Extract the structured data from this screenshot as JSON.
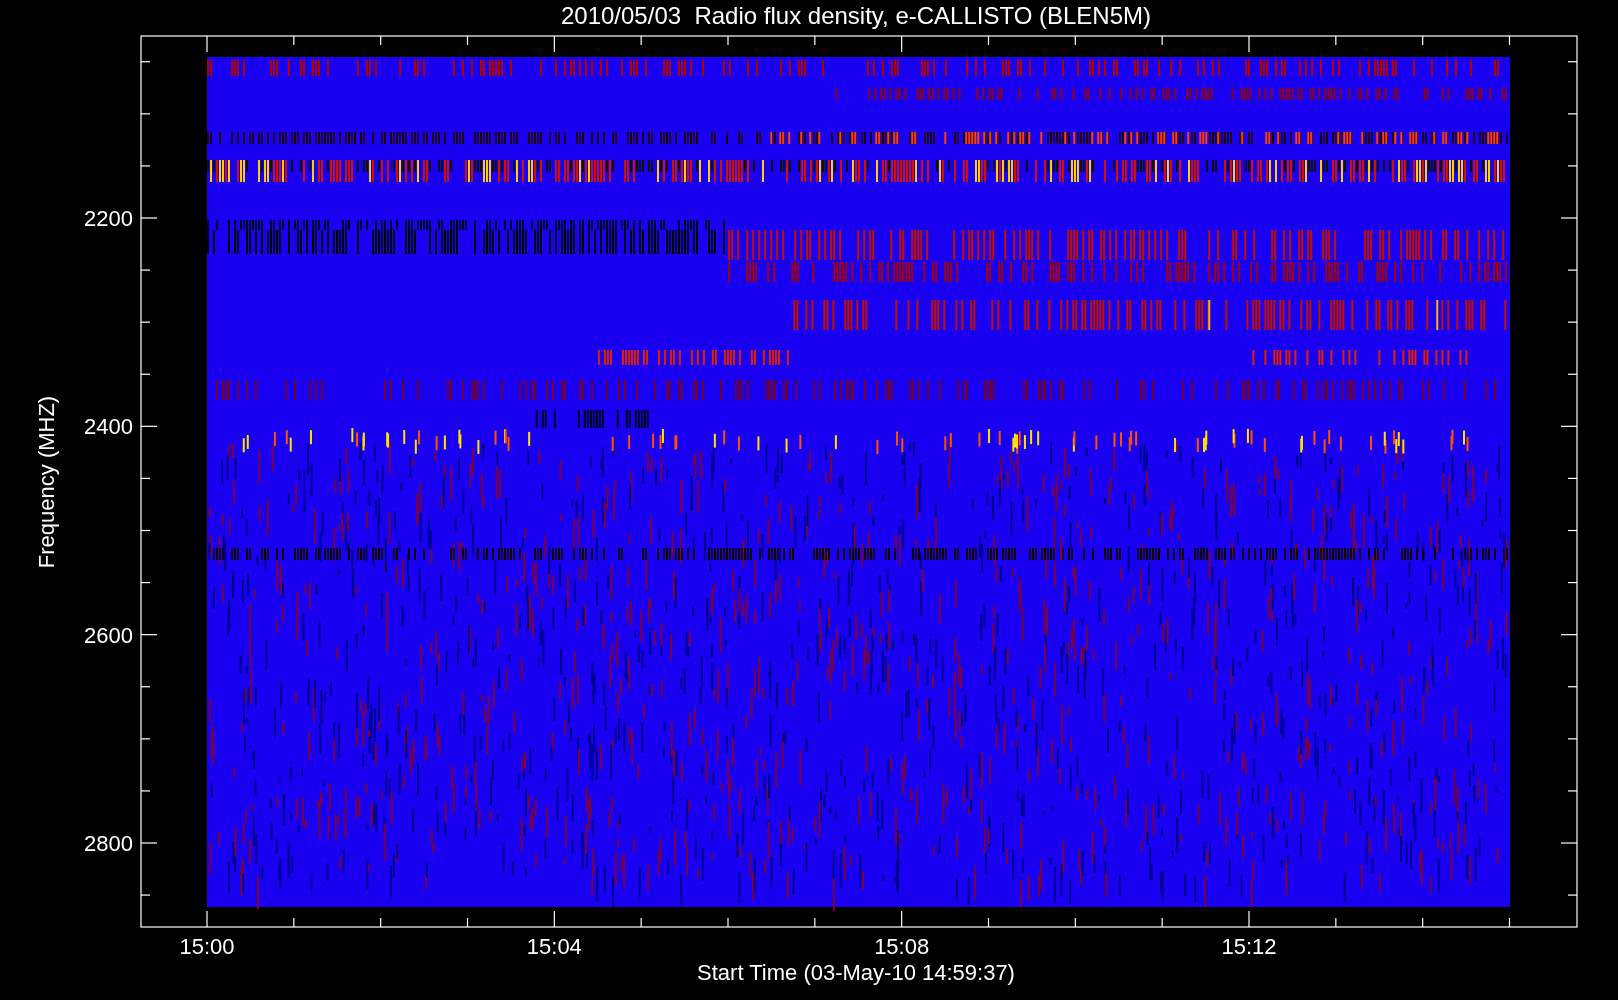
{
  "title": "2010/05/03  Radio flux density, e-CALLISTO (BLEN5M)",
  "x_axis": {
    "label": "Start Time (03-May-10 14:59:37)",
    "ticks": [
      "15:00",
      "15:04",
      "15:08",
      "15:12"
    ]
  },
  "y_axis": {
    "label": "Frequency (MHZ)",
    "ticks": [
      "2200",
      "2400",
      "2600",
      "2800"
    ]
  }
}
